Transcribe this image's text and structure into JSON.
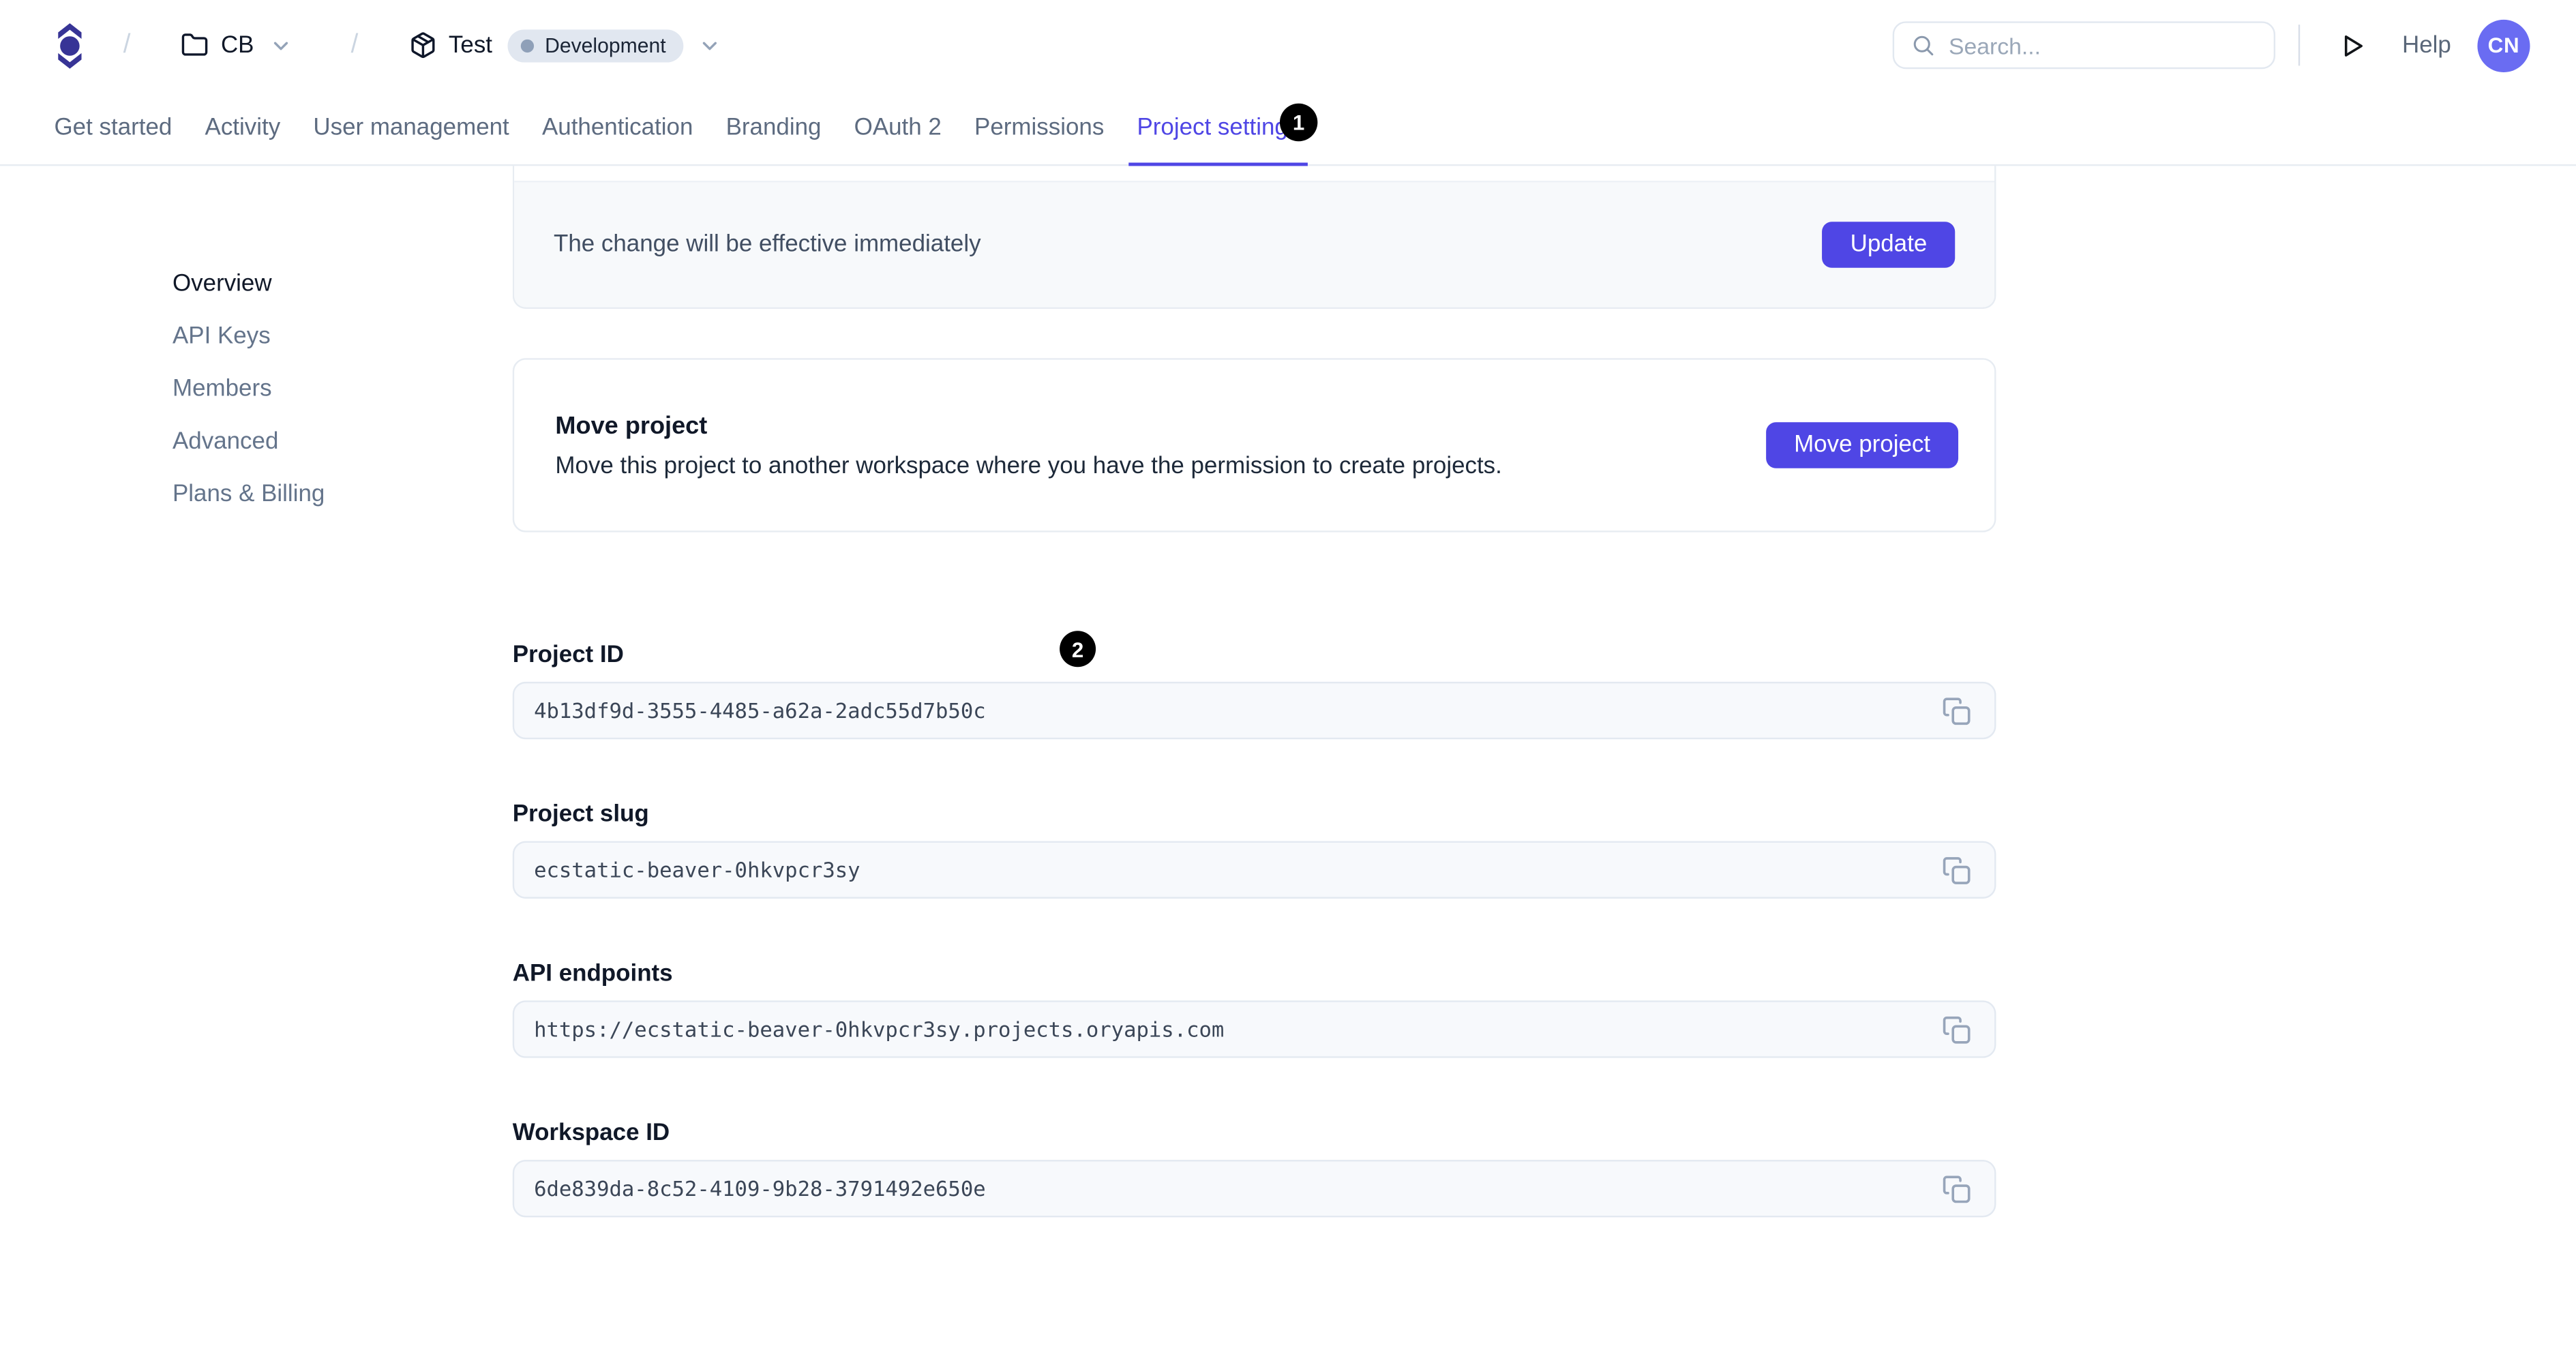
{
  "header": {
    "breadcrumb": {
      "separator": "/",
      "workspace": "CB",
      "project": "Test",
      "environment_badge": "Development"
    },
    "search": {
      "placeholder": "Search..."
    },
    "help_label": "Help",
    "avatar_initials": "CN"
  },
  "tabs": {
    "items": [
      {
        "label": "Get started",
        "active": false
      },
      {
        "label": "Activity",
        "active": false
      },
      {
        "label": "User management",
        "active": false
      },
      {
        "label": "Authentication",
        "active": false
      },
      {
        "label": "Branding",
        "active": false
      },
      {
        "label": "OAuth 2",
        "active": false
      },
      {
        "label": "Permissions",
        "active": false
      },
      {
        "label": "Project settings",
        "active": true
      }
    ]
  },
  "sidebar": {
    "items": [
      {
        "label": "Overview",
        "active": true
      },
      {
        "label": "API Keys",
        "active": false
      },
      {
        "label": "Members",
        "active": false
      },
      {
        "label": "Advanced",
        "active": false
      },
      {
        "label": "Plans & Billing",
        "active": false
      }
    ]
  },
  "main": {
    "update_card": {
      "note": "The change will be effective immediately",
      "button_label": "Update"
    },
    "move_card": {
      "title": "Move project",
      "description": "Move this project to another workspace where you have the permission to create projects.",
      "button_label": "Move project"
    },
    "fields": [
      {
        "label": "Project ID",
        "value": "4b13df9d-3555-4485-a62a-2adc55d7b50c"
      },
      {
        "label": "Project slug",
        "value": "ecstatic-beaver-0hkvpcr3sy"
      },
      {
        "label": "API endpoints",
        "value": "https://ecstatic-beaver-0hkvpcr3sy.projects.oryapis.com"
      },
      {
        "label": "Workspace ID",
        "value": "6de839da-8c52-4109-9b28-3791492e650e"
      }
    ]
  },
  "annotations": {
    "mark1": "1",
    "mark2": "2"
  },
  "colors": {
    "accent": "#4f46e5",
    "logo": "#373496",
    "avatar_bg": "#6a6cf2",
    "badge_bg": "#e1e7f0",
    "badge_dot": "#8fa0b8",
    "card_footer_bg": "#f7f9fb",
    "field_bg": "#f7f9fc",
    "border": "#e7ecf2",
    "annotation_bg": "#000000"
  }
}
